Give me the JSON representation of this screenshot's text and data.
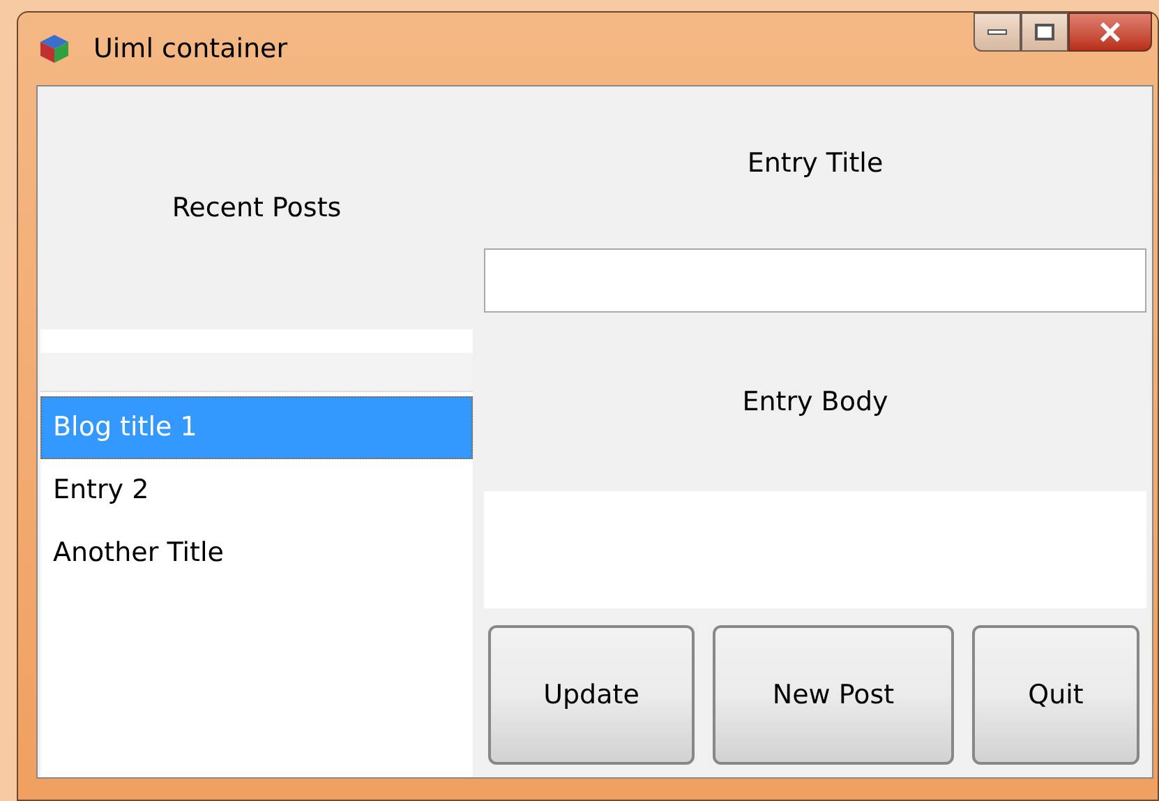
{
  "window": {
    "title": "Uiml container"
  },
  "left": {
    "label": "Recent Posts",
    "items": [
      {
        "label": "Blog title 1",
        "selected": true
      },
      {
        "label": "Entry 2",
        "selected": false
      },
      {
        "label": "Another Title",
        "selected": false
      }
    ]
  },
  "right": {
    "title_label": "Entry Title",
    "body_label": "Entry Body"
  },
  "buttons": [
    "Update",
    "New Post",
    "Quit"
  ]
}
